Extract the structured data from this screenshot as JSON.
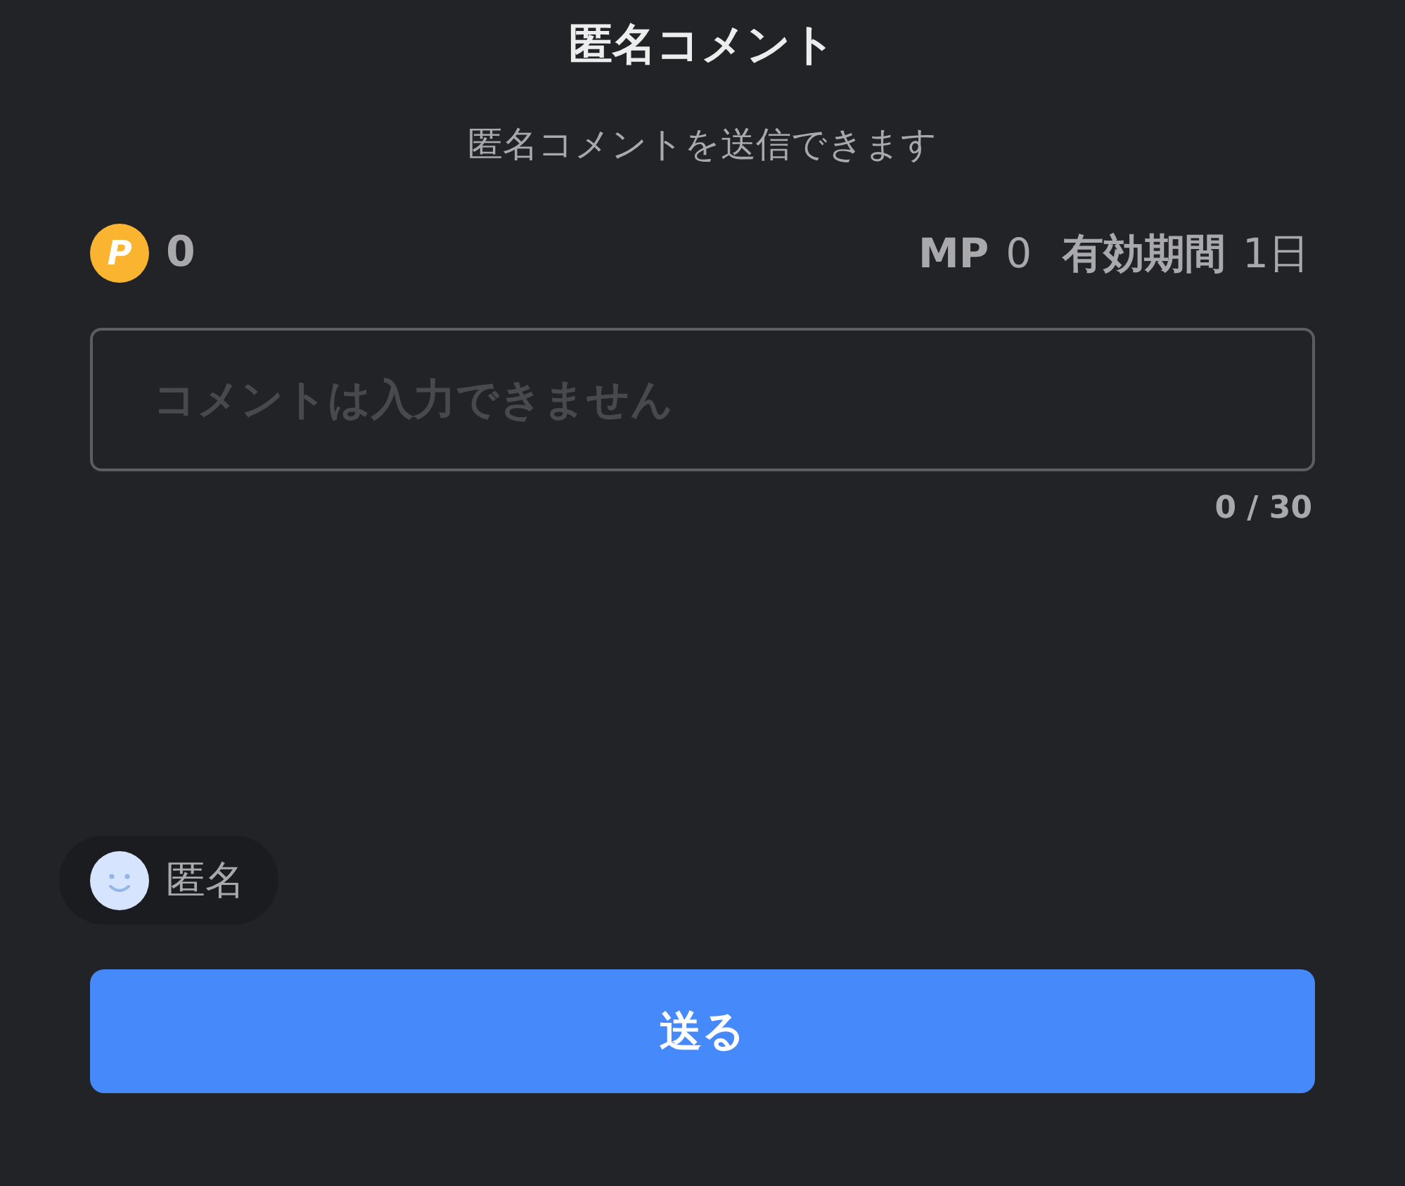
{
  "header": {
    "title": "匿名コメント",
    "subtitle": "匿名コメントを送信できます"
  },
  "balance": {
    "coin_symbol": "P",
    "points": "0",
    "mp_label": "MP",
    "mp_value": "0",
    "validity_label": "有効期間",
    "validity_value": "1日"
  },
  "comment_field": {
    "placeholder": "コメントは入力できません",
    "counter": "0 / 30"
  },
  "identity": {
    "label": "匿名"
  },
  "send_button": {
    "label": "送る"
  }
}
